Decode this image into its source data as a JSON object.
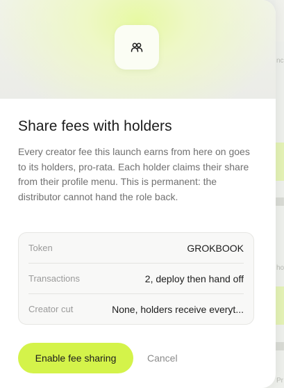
{
  "dialog": {
    "icon": "users-icon",
    "title": "Share fees with holders",
    "description": "Every creator fee this launch earns from here on goes to its holders, pro-rata. Each holder claims their share from their profile menu. This is permanent: the distributor cannot hand the role back.",
    "details": [
      {
        "label": "Token",
        "value": "GROKBOOK"
      },
      {
        "label": "Transactions",
        "value": "2, deploy then hand off"
      },
      {
        "label": "Creator cut",
        "value": "None, holders receive everyt..."
      }
    ],
    "primary_button": "Enable fee sharing",
    "cancel_button": "Cancel"
  },
  "background": {
    "fragments": [
      "nc",
      "ho",
      "Pr"
    ]
  },
  "colors": {
    "accent": "#d4f34a",
    "hero_glow": "#e7f9a3"
  }
}
